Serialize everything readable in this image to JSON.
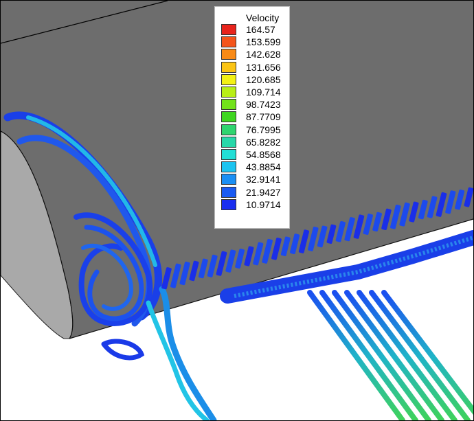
{
  "legend": {
    "title": "Velocity",
    "levels": [
      {
        "label": "164.57",
        "color": "#e8241c"
      },
      {
        "label": "153.599",
        "color": "#f4541a"
      },
      {
        "label": "142.628",
        "color": "#f98a16"
      },
      {
        "label": "131.656",
        "color": "#fbc414"
      },
      {
        "label": "120.685",
        "color": "#f3f115"
      },
      {
        "label": "109.714",
        "color": "#b8ef17"
      },
      {
        "label": "98.7423",
        "color": "#72e21b"
      },
      {
        "label": "87.7709",
        "color": "#3ed620"
      },
      {
        "label": "76.7995",
        "color": "#2fd56f"
      },
      {
        "label": "65.8282",
        "color": "#27d8a9"
      },
      {
        "label": "54.8568",
        "color": "#22dfd6"
      },
      {
        "label": "43.8854",
        "color": "#1cc4f0"
      },
      {
        "label": "32.9141",
        "color": "#1a8ff4"
      },
      {
        "label": "21.9427",
        "color": "#1a5bf2"
      },
      {
        "label": "10.9714",
        "color": "#1a2ef0"
      }
    ]
  },
  "colors": {
    "body_top": "#6d6d6d",
    "body_front": "#a9a9a9",
    "ground": "#ffffff"
  }
}
